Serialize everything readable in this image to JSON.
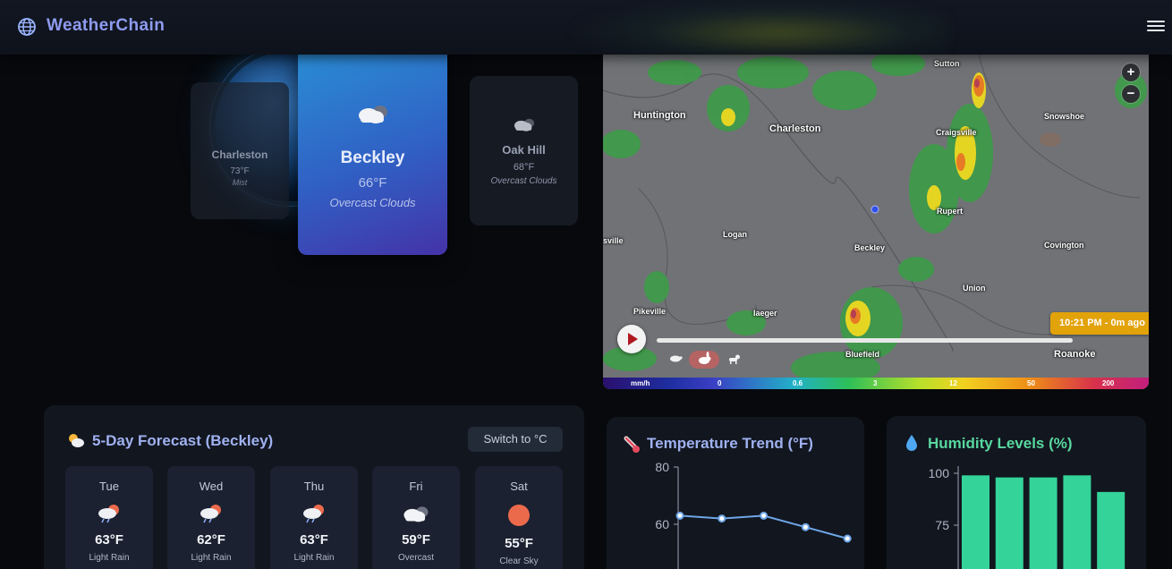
{
  "header": {
    "app_title": "WeatherChain",
    "logo_icon": "globe-icon",
    "menu_icon": "hamburger-menu-icon"
  },
  "cities": {
    "charleston": {
      "name": "Charleston",
      "temp": "73°F",
      "desc": "Mist"
    },
    "active": {
      "name": "Beckley",
      "temp": "66°F",
      "desc": "Overcast Clouds",
      "icon": "cloud-icon"
    },
    "oakhill": {
      "name": "Oak Hill",
      "temp": "68°F",
      "desc": "Overcast Clouds",
      "icon": "cloud-icon"
    }
  },
  "map": {
    "labels": {
      "huntington": "Huntington",
      "charleston": "Charleston",
      "sutton": "Sutton",
      "craigsville": "Craigsville",
      "snowshoe": "Snowshoe",
      "rupert": "Rupert",
      "logan": "Logan",
      "beckley": "Beckley",
      "covington": "Covington",
      "union": "Union",
      "pikeville": "Pikeville",
      "iaeger": "Iaeger",
      "bluefield": "Bluefield",
      "roanoke": "Roanoke",
      "sville": "sville"
    },
    "zoom_in": "+",
    "zoom_out": "−",
    "time_tag": "10:21 PM - 0m ago",
    "legend": {
      "unit": "mm/h",
      "ticks": [
        "0",
        "0.6",
        "3",
        "12",
        "50",
        "200"
      ]
    },
    "colors": {
      "timeline_accent": "#e2a20a",
      "play_icon": "#b0181f"
    }
  },
  "forecast": {
    "title": "5-Day Forecast (Beckley)",
    "switch_label": "Switch to °C",
    "days": [
      {
        "day": "Tue",
        "temp": "63°F",
        "desc": "Light Rain",
        "icon": "rain-sun-icon"
      },
      {
        "day": "Wed",
        "temp": "62°F",
        "desc": "Light Rain",
        "icon": "rain-sun-icon"
      },
      {
        "day": "Thu",
        "temp": "63°F",
        "desc": "Light Rain",
        "icon": "rain-sun-icon"
      },
      {
        "day": "Fri",
        "temp": "59°F",
        "desc": "Overcast",
        "icon": "cloud-icon"
      },
      {
        "day": "Sat",
        "temp": "55°F",
        "desc": "Clear Sky",
        "icon": "sun-icon"
      }
    ]
  },
  "temp_trend": {
    "title": "Temperature Trend (°F)",
    "icon": "thermometer-icon"
  },
  "humidity": {
    "title": "Humidity Levels (%)",
    "icon": "droplet-icon"
  },
  "chart_data": [
    {
      "type": "line",
      "title": "Temperature Trend (°F)",
      "yticks": [
        80,
        60
      ],
      "values": [
        63,
        62,
        63,
        59,
        55
      ],
      "color": "#6ea6e8"
    },
    {
      "type": "bar",
      "title": "Humidity Levels (%)",
      "yticks": [
        100,
        75
      ],
      "values": [
        99,
        98,
        98,
        99,
        91
      ],
      "color": "#34d399"
    }
  ]
}
